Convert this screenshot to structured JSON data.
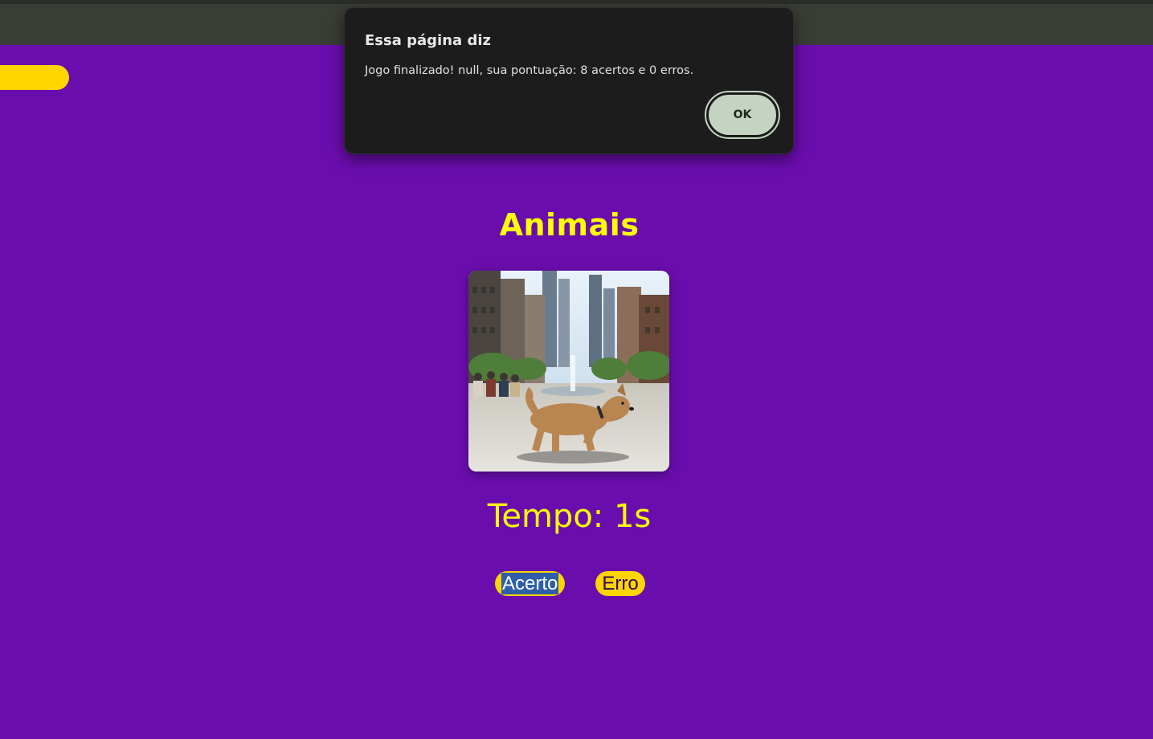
{
  "dialog": {
    "title": "Essa página diz",
    "message": "Jogo finalizado! null, sua pontuação: 8 acertos e 0 erros.",
    "ok_label": "OK"
  },
  "game": {
    "title": "Animais",
    "timer": "Tempo: 1s",
    "image_subject": "dog walking in a city plaza",
    "buttons": {
      "acerto": "Acerto",
      "erro": "Erro"
    }
  },
  "colors": {
    "background": "#6a0dad",
    "accent": "#ffd500",
    "title_text": "#ffff00",
    "dialog_bg": "#1c1c1c",
    "ok_button": "#c5d4c2"
  }
}
